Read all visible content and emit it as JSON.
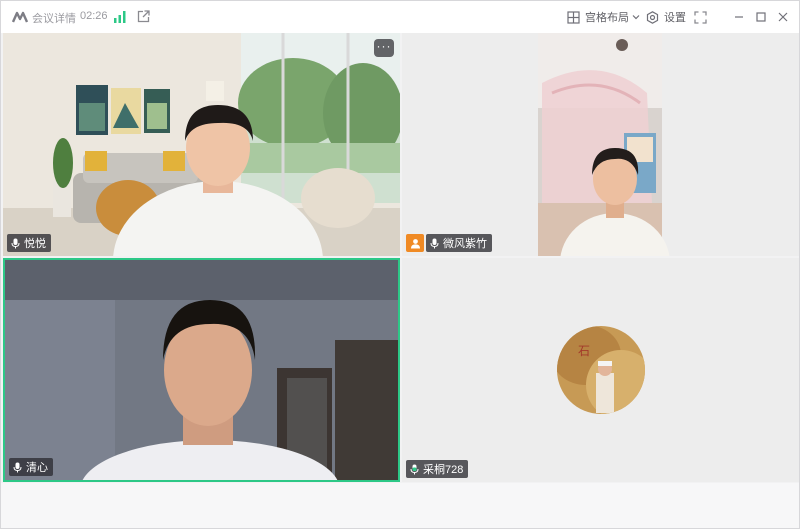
{
  "titlebar": {
    "meeting_details_label": "会议详情",
    "timer": "02:26",
    "grid_layout_label": "宫格布局",
    "settings_label": "设置"
  },
  "participants": [
    {
      "name": "悦悦"
    },
    {
      "name": "微风紫竹"
    },
    {
      "name": "清心"
    },
    {
      "name": "采桐728"
    }
  ],
  "tile_more_label": "···",
  "colors": {
    "active_speaker_border": "#2dc887",
    "host_badge": "#f08a24",
    "name_tag_bg": "#2d2d32"
  }
}
